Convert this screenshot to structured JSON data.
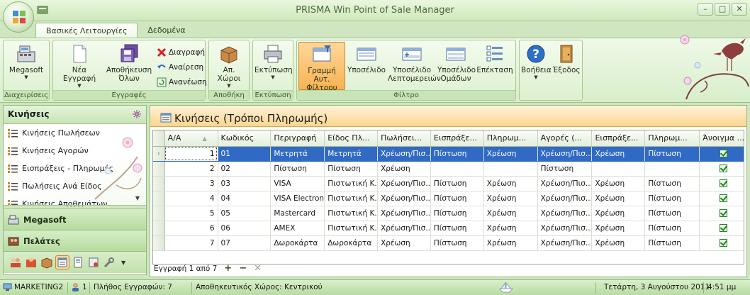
{
  "window": {
    "title": "PRISMA Win Point of Sale Manager",
    "controls": {
      "minimize": "–",
      "maximize": "□",
      "close": "✕"
    }
  },
  "ribbon_tabs": [
    {
      "label": "Βασικές Λειτουργίες",
      "active": true
    },
    {
      "label": "Δεδομένα",
      "active": false
    }
  ],
  "ribbon": {
    "groups": {
      "admin": "Διαχειρίσεις",
      "records": "Εγγραφές",
      "warehouse": "Αποθήκη",
      "print": "Εκτύπωση",
      "filter": "Φίλτρο"
    },
    "buttons": {
      "megasoft": "Megasoft",
      "new_record": "Νέα Εγγραφή",
      "save_all_1": "Αποθήκευση",
      "save_all_2": "Όλων",
      "delete": "Διαγραφή",
      "undo": "Αναίρεση",
      "refresh": "Ανανέωση",
      "warehouses": "Απ. Χώροι",
      "print": "Εκτύπωση",
      "filter_row_1": "Γραμμή Αυτ.",
      "filter_row_2": "Φίλτρου",
      "footer": "Υποσέλιδο",
      "detail_footer_1": "Υποσέλιδο",
      "detail_footer_2": "Λεπτομερειών",
      "group_footer_1": "Υποσέλιδο",
      "group_footer_2": "Ομάδων",
      "expand": "Επέκταση",
      "help": "Βοήθεια",
      "exit": "Έξοδος"
    }
  },
  "sidebar": {
    "header": "Κινήσεις",
    "items": [
      {
        "label": "Κινήσεις Πωλήσεων"
      },
      {
        "label": "Κινήσεις Αγορών"
      },
      {
        "label": "Εισπράξεις - Πληρωμές"
      },
      {
        "label": "Πωλήσεις Ανά Είδος"
      },
      {
        "label": "Κινήσεις Αποθεμάτων"
      }
    ],
    "sections": [
      {
        "label": "Megasoft"
      },
      {
        "label": "Πελάτες"
      }
    ]
  },
  "panel": {
    "title": "Κινήσεις (Τρόποι Πληρωμής)",
    "columns": [
      "Α/Α",
      "Κωδικός",
      "Περιγραφή",
      "Είδος Πλ...",
      "Πωλήσει...",
      "Εισπράξε...",
      "Πληρωμ...",
      "Αγορές (...",
      "Εισπράξε...",
      "Πληρωμ...",
      "Άνοιγμα ..."
    ],
    "rows": [
      {
        "aa": "1",
        "code": "01",
        "desc": "Μετρητά",
        "type": "Μετρητά",
        "sales": "Χρέωση/Πισ...",
        "rec1": "Πίστωση",
        "pay1": "Χρέωση",
        "purch": "Χρέωση/Πισ...",
        "rec2": "Χρέωση",
        "pay2": "Πίστωση",
        "drawer": true
      },
      {
        "aa": "2",
        "code": "02",
        "desc": "Πίστωση",
        "type": "Πίστωση",
        "sales": "Χρέωση",
        "rec1": "",
        "pay1": "",
        "purch": "Πίστωση",
        "rec2": "",
        "pay2": "",
        "drawer": true
      },
      {
        "aa": "3",
        "code": "03",
        "desc": "VISA",
        "type": "Πιστωτική Κ...",
        "sales": "Χρέωση/Πισ...",
        "rec1": "Πίστωση",
        "pay1": "Χρέωση",
        "purch": "Χρέωση/Πισ...",
        "rec2": "Χρέωση",
        "pay2": "Πίστωση",
        "drawer": true
      },
      {
        "aa": "4",
        "code": "04",
        "desc": "VISA Electron",
        "type": "Πιστωτική Κ...",
        "sales": "Χρέωση/Πισ...",
        "rec1": "Πίστωση",
        "pay1": "Χρέωση",
        "purch": "Χρέωση/Πισ...",
        "rec2": "Χρέωση",
        "pay2": "Πίστωση",
        "drawer": true
      },
      {
        "aa": "5",
        "code": "05",
        "desc": "Mastercard",
        "type": "Πιστωτική Κ...",
        "sales": "Χρέωση/Πισ...",
        "rec1": "Πίστωση",
        "pay1": "Χρέωση",
        "purch": "Χρέωση/Πισ...",
        "rec2": "Χρέωση",
        "pay2": "Πίστωση",
        "drawer": true
      },
      {
        "aa": "6",
        "code": "06",
        "desc": "AMEX",
        "type": "Πιστωτική Κ...",
        "sales": "Χρέωση/Πισ...",
        "rec1": "Πίστωση",
        "pay1": "Χρέωση",
        "purch": "Χρέωση/Πισ...",
        "rec2": "Χρέωση",
        "pay2": "Πίστωση",
        "drawer": true
      },
      {
        "aa": "7",
        "code": "07",
        "desc": "Δωροκάρτα",
        "type": "Δωροκάρτα",
        "sales": "Χρέωση",
        "rec1": "Πίστωση",
        "pay1": "Χρέωση",
        "purch": "Χρέωση/Πισ...",
        "rec2": "Χρέωση",
        "pay2": "Πίστωση",
        "drawer": true
      }
    ],
    "selected_row": 0,
    "navigator": {
      "text": "Εγγραφή 1 από 7",
      "add": "+",
      "remove": "−",
      "cancel": "✕"
    }
  },
  "statusbar": {
    "workstation": "MARKETING2",
    "users": "1",
    "record_count": "Πλήθος Εγγραφών: 7",
    "warehouse": "Αποθηκευτικός Χώρος: Κεντρικού",
    "date": "Τετάρτη, 3 Αυγούστου 2011",
    "time": "4:51 μμ"
  },
  "colors": {
    "ribbon_bg": "#d8eecb",
    "selection": "#316ac5",
    "panel_header": "#f9d58f",
    "accent_green": "#95bd7e"
  }
}
